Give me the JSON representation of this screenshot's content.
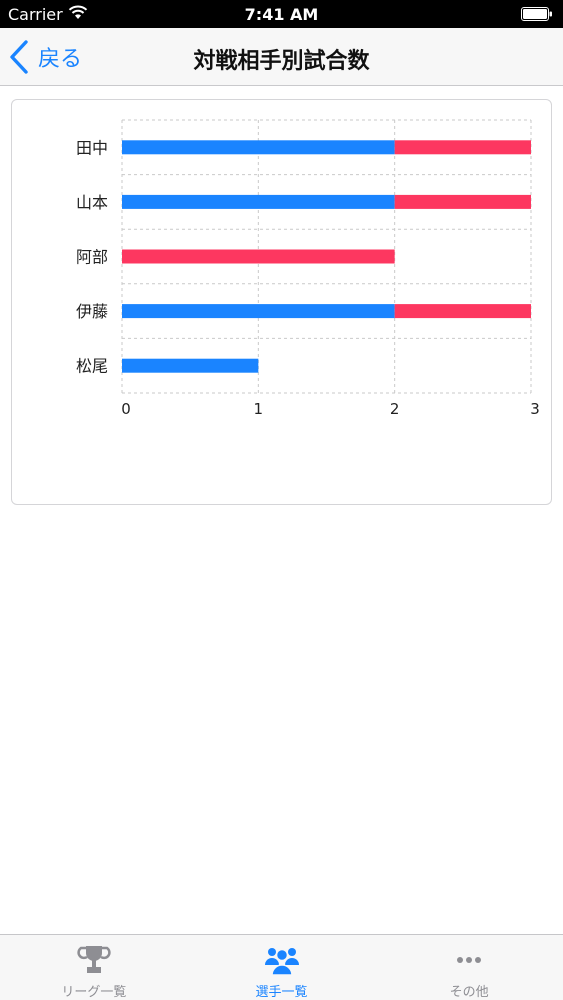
{
  "status_bar": {
    "carrier": "Carrier",
    "time": "7:41 AM"
  },
  "nav": {
    "back_label": "戻る",
    "title": "対戦相手別試合数"
  },
  "colors": {
    "blue": "#1a84ff",
    "red": "#fd3760",
    "grid": "#c9c9c9"
  },
  "chart_data": {
    "type": "bar",
    "orientation": "horizontal",
    "stacked": true,
    "categories": [
      "田中",
      "山本",
      "阿部",
      "伊藤",
      "松尾"
    ],
    "series": [
      {
        "color": "#1a84ff",
        "values": [
          2,
          2,
          0,
          2,
          1
        ]
      },
      {
        "color": "#fd3760",
        "values": [
          1,
          1,
          2,
          1,
          0
        ]
      }
    ],
    "xlim": [
      0,
      3
    ],
    "x_ticks": [
      "0",
      "1",
      "2",
      "3"
    ],
    "grid": true,
    "legend": "none"
  },
  "tabs": [
    {
      "label": "リーグ一覧",
      "icon": "trophy-icon",
      "active": false
    },
    {
      "label": "選手一覧",
      "icon": "people-icon",
      "active": true
    },
    {
      "label": "その他",
      "icon": "more-icon",
      "active": false
    }
  ]
}
